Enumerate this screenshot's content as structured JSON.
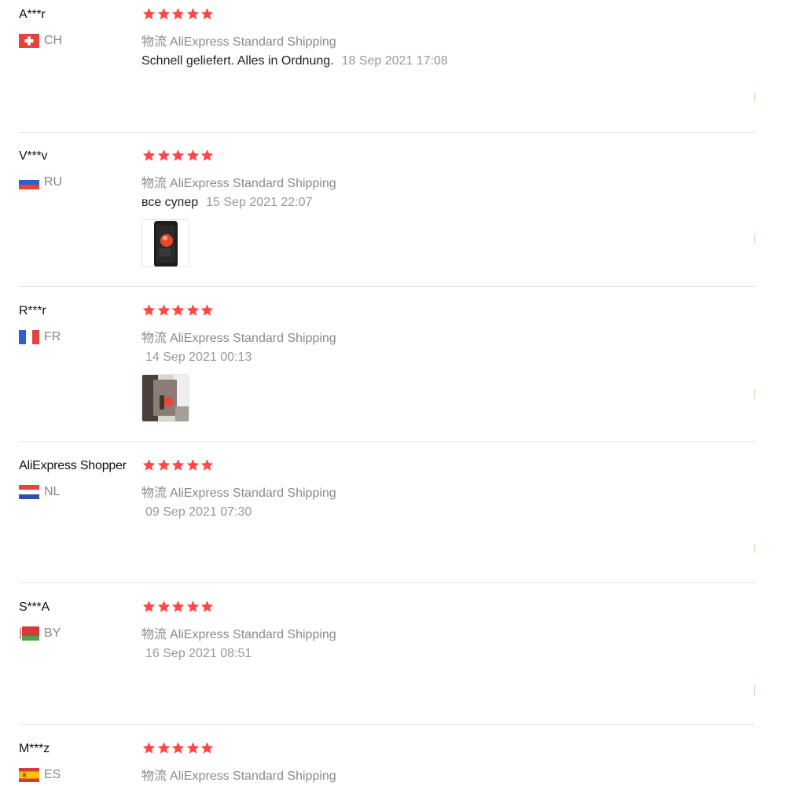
{
  "shipping_label": "物流",
  "colors": {
    "star": "#ff4747",
    "muted_text": "#999999",
    "divider": "#e6e6e6"
  },
  "reviews": [
    {
      "user": "A***r",
      "country": "CH",
      "flag_icon": "switzerland-flag-icon",
      "stars": 5,
      "shipping": "AliExpress Standard Shipping",
      "text": "Schnell geliefert. Alles in Ordnung.",
      "date": "18 Sep 2021 17:08",
      "has_photo": false
    },
    {
      "user": "V***v",
      "country": "RU",
      "flag_icon": "russia-flag-icon",
      "stars": 5,
      "shipping": "AliExpress Standard Shipping",
      "text": "все супер",
      "date": "15 Sep 2021 22:07",
      "has_photo": true,
      "photo_icon": "product-photo-thumbnail"
    },
    {
      "user": "R***r",
      "country": "FR",
      "flag_icon": "france-flag-icon",
      "stars": 5,
      "shipping": "AliExpress Standard Shipping",
      "text": "",
      "date": "14 Sep 2021 00:13",
      "has_photo": true,
      "photo_icon": "product-photo-thumbnail"
    },
    {
      "user": "AliExpress Shopper",
      "country": "NL",
      "flag_icon": "netherlands-flag-icon",
      "stars": 5,
      "shipping": "AliExpress Standard Shipping",
      "text": "",
      "date": "09 Sep 2021 07:30",
      "has_photo": false
    },
    {
      "user": "S***A",
      "country": "BY",
      "flag_icon": "belarus-flag-icon",
      "stars": 5,
      "shipping": "AliExpress Standard Shipping",
      "text": "",
      "date": "16 Sep 2021 08:51",
      "has_photo": false
    },
    {
      "user": "M***z",
      "country": "ES",
      "flag_icon": "spain-flag-icon",
      "stars": 5,
      "shipping": "AliExpress Standard Shipping",
      "text": "",
      "date": "",
      "has_photo": false
    }
  ]
}
